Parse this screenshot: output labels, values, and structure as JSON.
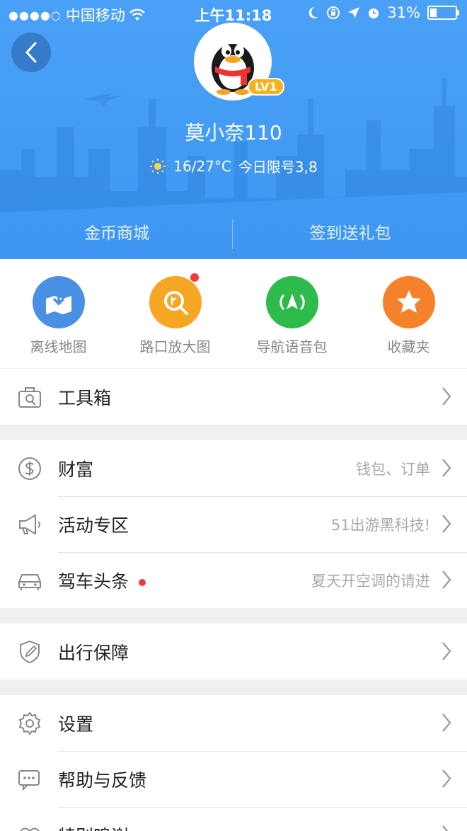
{
  "status_bar": {
    "signal_dots": "●●●●○",
    "carrier": "中国移动",
    "time": "上午11:18",
    "battery_percent": "31%",
    "battery_level": 0.31
  },
  "profile": {
    "username": "莫小奈110",
    "level_badge": "LV1",
    "temperature": "16/27°C",
    "restriction": "今日限号3,8"
  },
  "header_tabs": [
    "金币商城",
    "签到送礼包"
  ],
  "quick_actions": [
    {
      "label": "离线地图",
      "icon": "offline-map-icon",
      "color": "#4a90e2"
    },
    {
      "label": "路口放大图",
      "icon": "junction-zoom-icon",
      "color": "#f5a623",
      "has_dot": true
    },
    {
      "label": "导航语音包",
      "icon": "voice-pack-icon",
      "color": "#2fba4c"
    },
    {
      "label": "收藏夹",
      "icon": "favorites-icon",
      "color": "#f5822a"
    }
  ],
  "menu": {
    "toolbox": {
      "title": "工具箱",
      "icon": "toolbox-icon"
    },
    "wealth": {
      "title": "财富",
      "subtitle": "钱包、订单",
      "icon": "dollar-icon"
    },
    "activities": {
      "title": "活动专区",
      "subtitle": "51出游黑科技!",
      "icon": "megaphone-icon"
    },
    "driving_news": {
      "title": "驾车头条",
      "subtitle": "夏天开空调的请进",
      "icon": "car-icon"
    },
    "travel_guarantee": {
      "title": "出行保障",
      "icon": "shield-icon"
    },
    "settings": {
      "title": "设置",
      "icon": "gear-icon"
    },
    "help": {
      "title": "帮助与反馈",
      "icon": "chat-icon"
    },
    "special": {
      "title": "特别鸣谢",
      "icon": "thanks-icon"
    }
  },
  "colors": {
    "header_blue": "#4aa1f6",
    "badge": "#f6b21c",
    "alert_dot": "#ef3b3b"
  }
}
